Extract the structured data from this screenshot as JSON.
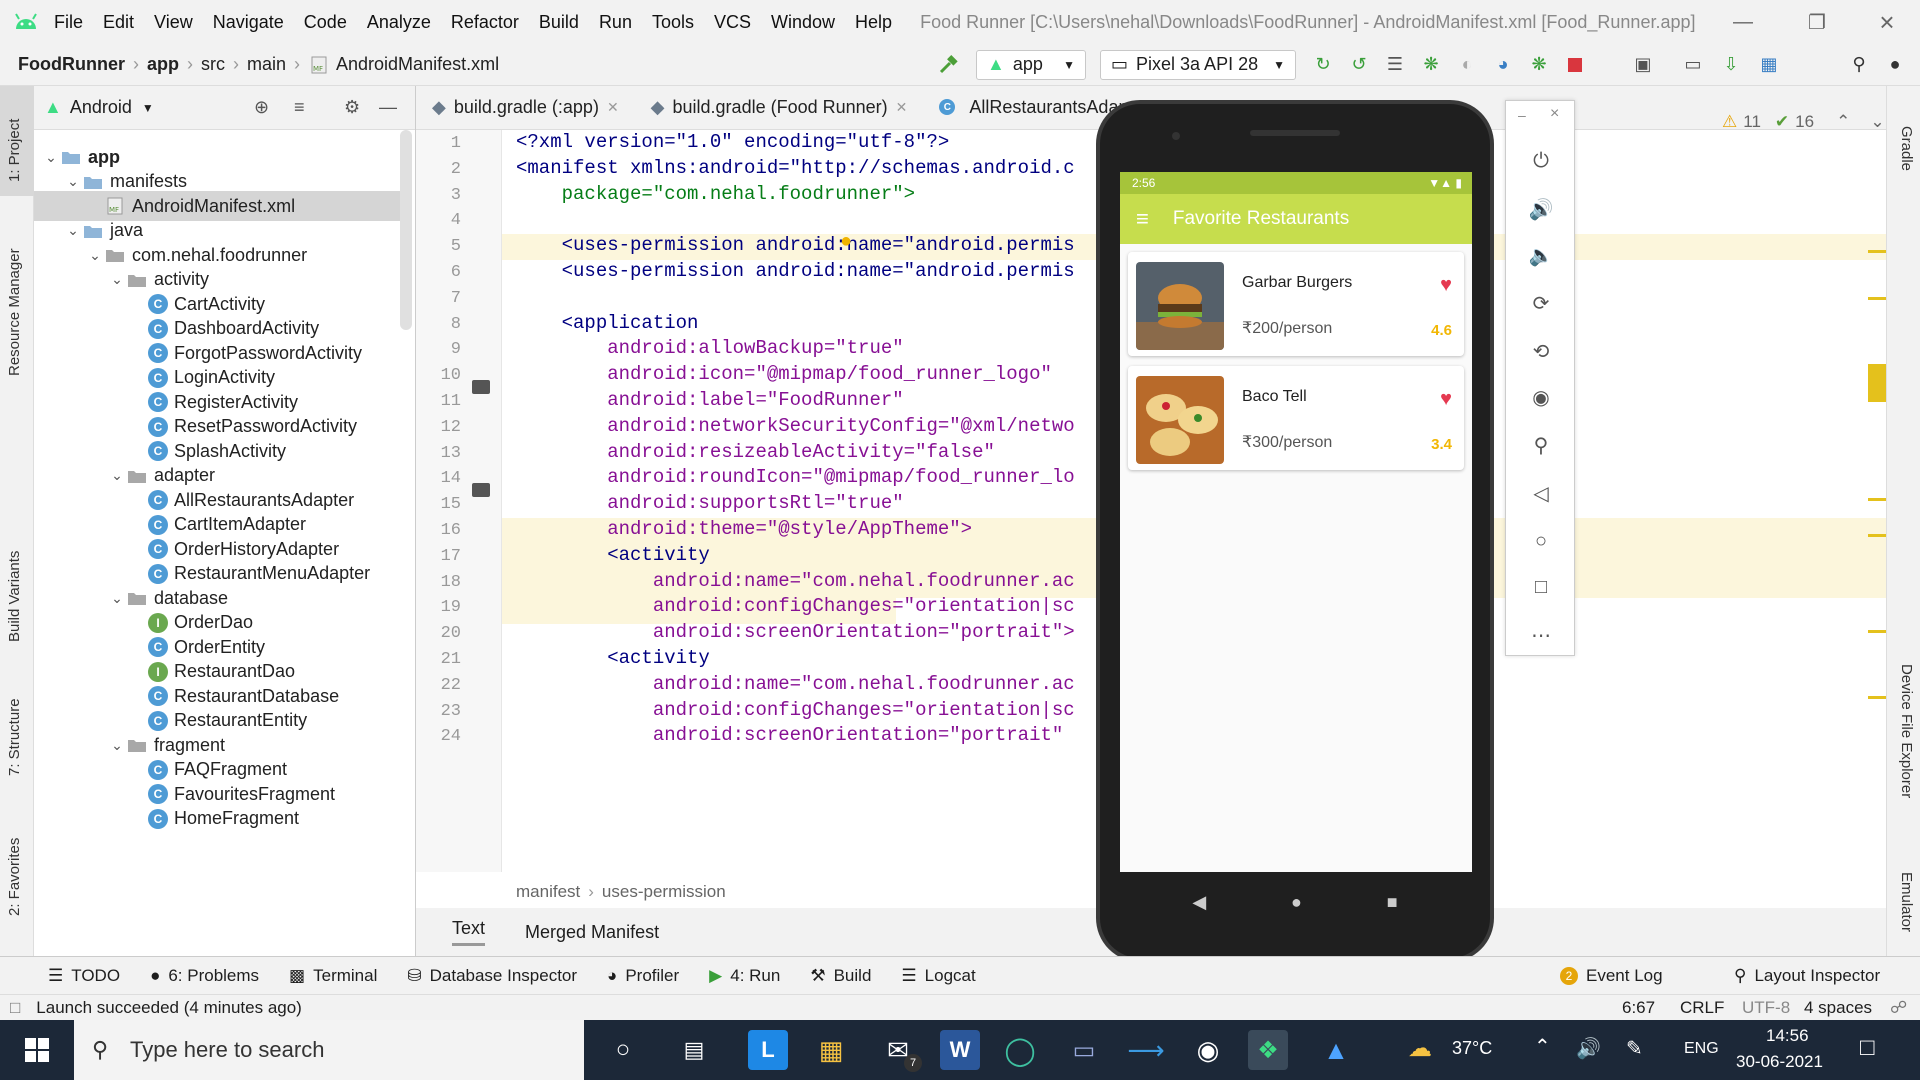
{
  "menubar": {
    "items": [
      "File",
      "Edit",
      "View",
      "Navigate",
      "Code",
      "Analyze",
      "Refactor",
      "Build",
      "Run",
      "Tools",
      "VCS",
      "Window",
      "Help"
    ],
    "title": "Food Runner [C:\\Users\\nehal\\Downloads\\FoodRunner] - AndroidManifest.xml [Food_Runner.app]"
  },
  "navbar": {
    "crumbs": [
      "FoodRunner",
      "app",
      "src",
      "main",
      "AndroidManifest.xml"
    ],
    "run_config": "app",
    "device": "Pixel 3a API 28"
  },
  "left_strip": {
    "project": "1: Project",
    "resource": "Resource Manager",
    "variants": "Build Variants",
    "structure": "7: Structure",
    "favorites": "2: Favorites"
  },
  "right_strip": {
    "gradle": "Gradle",
    "device_explorer": "Device File Explorer",
    "emulator": "Emulator"
  },
  "project": {
    "view": "Android",
    "tree": [
      {
        "label": "app",
        "bold": true
      },
      {
        "label": "manifests"
      },
      {
        "label": "AndroidManifest.xml"
      },
      {
        "label": "java"
      },
      {
        "label": "com.nehal.foodrunner"
      },
      {
        "label": "activity"
      },
      {
        "label": "CartActivity"
      },
      {
        "label": "DashboardActivity"
      },
      {
        "label": "ForgotPasswordActivity"
      },
      {
        "label": "LoginActivity"
      },
      {
        "label": "RegisterActivity"
      },
      {
        "label": "ResetPasswordActivity"
      },
      {
        "label": "SplashActivity"
      },
      {
        "label": "adapter"
      },
      {
        "label": "AllRestaurantsAdapter"
      },
      {
        "label": "CartItemAdapter"
      },
      {
        "label": "OrderHistoryAdapter"
      },
      {
        "label": "RestaurantMenuAdapter"
      },
      {
        "label": "database"
      },
      {
        "label": "OrderDao"
      },
      {
        "label": "OrderEntity"
      },
      {
        "label": "RestaurantDao"
      },
      {
        "label": "RestaurantDatabase"
      },
      {
        "label": "RestaurantEntity"
      },
      {
        "label": "fragment"
      },
      {
        "label": "FAQFragment"
      },
      {
        "label": "FavouritesFragment"
      },
      {
        "label": "HomeFragment"
      }
    ]
  },
  "editor": {
    "tabs": [
      "build.gradle (:app)",
      "build.gradle (Food Runner)",
      "AllRestaurantsAdap"
    ],
    "warnings": "11",
    "weak_warnings": "16",
    "lines": [
      "1",
      "2",
      "3",
      "4",
      "5",
      "6",
      "7",
      "8",
      "9",
      "10",
      "11",
      "12",
      "13",
      "14",
      "15",
      "16",
      "17",
      "18",
      "19",
      "20",
      "21",
      "22",
      "23",
      "24"
    ],
    "code": [
      "<?xml version=\"1.0\" encoding=\"utf-8\"?>",
      "<manifest xmlns:android=\"http://schemas.android.c",
      "    package=\"com.nehal.foodrunner\">",
      "",
      "    <uses-permission android:name=\"android.permis",
      "    <uses-permission android:name=\"android.permis",
      "",
      "    <application",
      "        android:allowBackup=\"true\"",
      "        android:icon=\"@mipmap/food_runner_logo\"",
      "        android:label=\"FoodRunner\"",
      "        android:networkSecurityConfig=\"@xml/netwo",
      "        android:resizeableActivity=\"false\"",
      "        android:roundIcon=\"@mipmap/food_runner_lo",
      "        android:supportsRtl=\"true\"",
      "        android:theme=\"@style/AppTheme\">",
      "        <activity",
      "            android:name=\"com.nehal.foodrunner.ac",
      "            android:configChanges=\"orientation|sc",
      "            android:screenOrientation=\"portrait\">",
      "        <activity",
      "            android:name=\"com.nehal.foodrunner.ac",
      "            android:configChanges=\"orientation|sc",
      "            android:screenOrientation=\"portrait\""
    ],
    "breadcrumb": [
      "manifest",
      "uses-permission"
    ],
    "bottom_tabs": [
      "Text",
      "Merged Manifest"
    ]
  },
  "phone": {
    "time": "2:56",
    "title": "Favorite Restaurants",
    "restaurants": [
      {
        "name": "Garbar Burgers",
        "price": "200/person",
        "rating": "4.6"
      },
      {
        "name": "Baco Tell",
        "price": "300/person",
        "rating": "3.4"
      }
    ]
  },
  "bottombar": {
    "todo": "TODO",
    "problems": "6: Problems",
    "terminal": "Terminal",
    "db": "Database Inspector",
    "profiler": "Profiler",
    "run": "4: Run",
    "build": "Build",
    "logcat": "Logcat",
    "event_log": "Event Log",
    "layout_inspector": "Layout Inspector",
    "event_count": "2"
  },
  "status": {
    "message": "Launch succeeded (4 minutes ago)",
    "position": "6:67",
    "line_sep": "CRLF",
    "encoding": "UTF-8",
    "indent": "4 spaces"
  },
  "taskbar": {
    "search_placeholder": "Type here to search",
    "temp": "37°C",
    "lang": "ENG",
    "time": "14:56",
    "date": "30-06-2021",
    "mail_badge": "7"
  },
  "colors": {
    "accent_green": "#c6dd4d",
    "heart": "#e53950",
    "rating": "#f2b705"
  }
}
